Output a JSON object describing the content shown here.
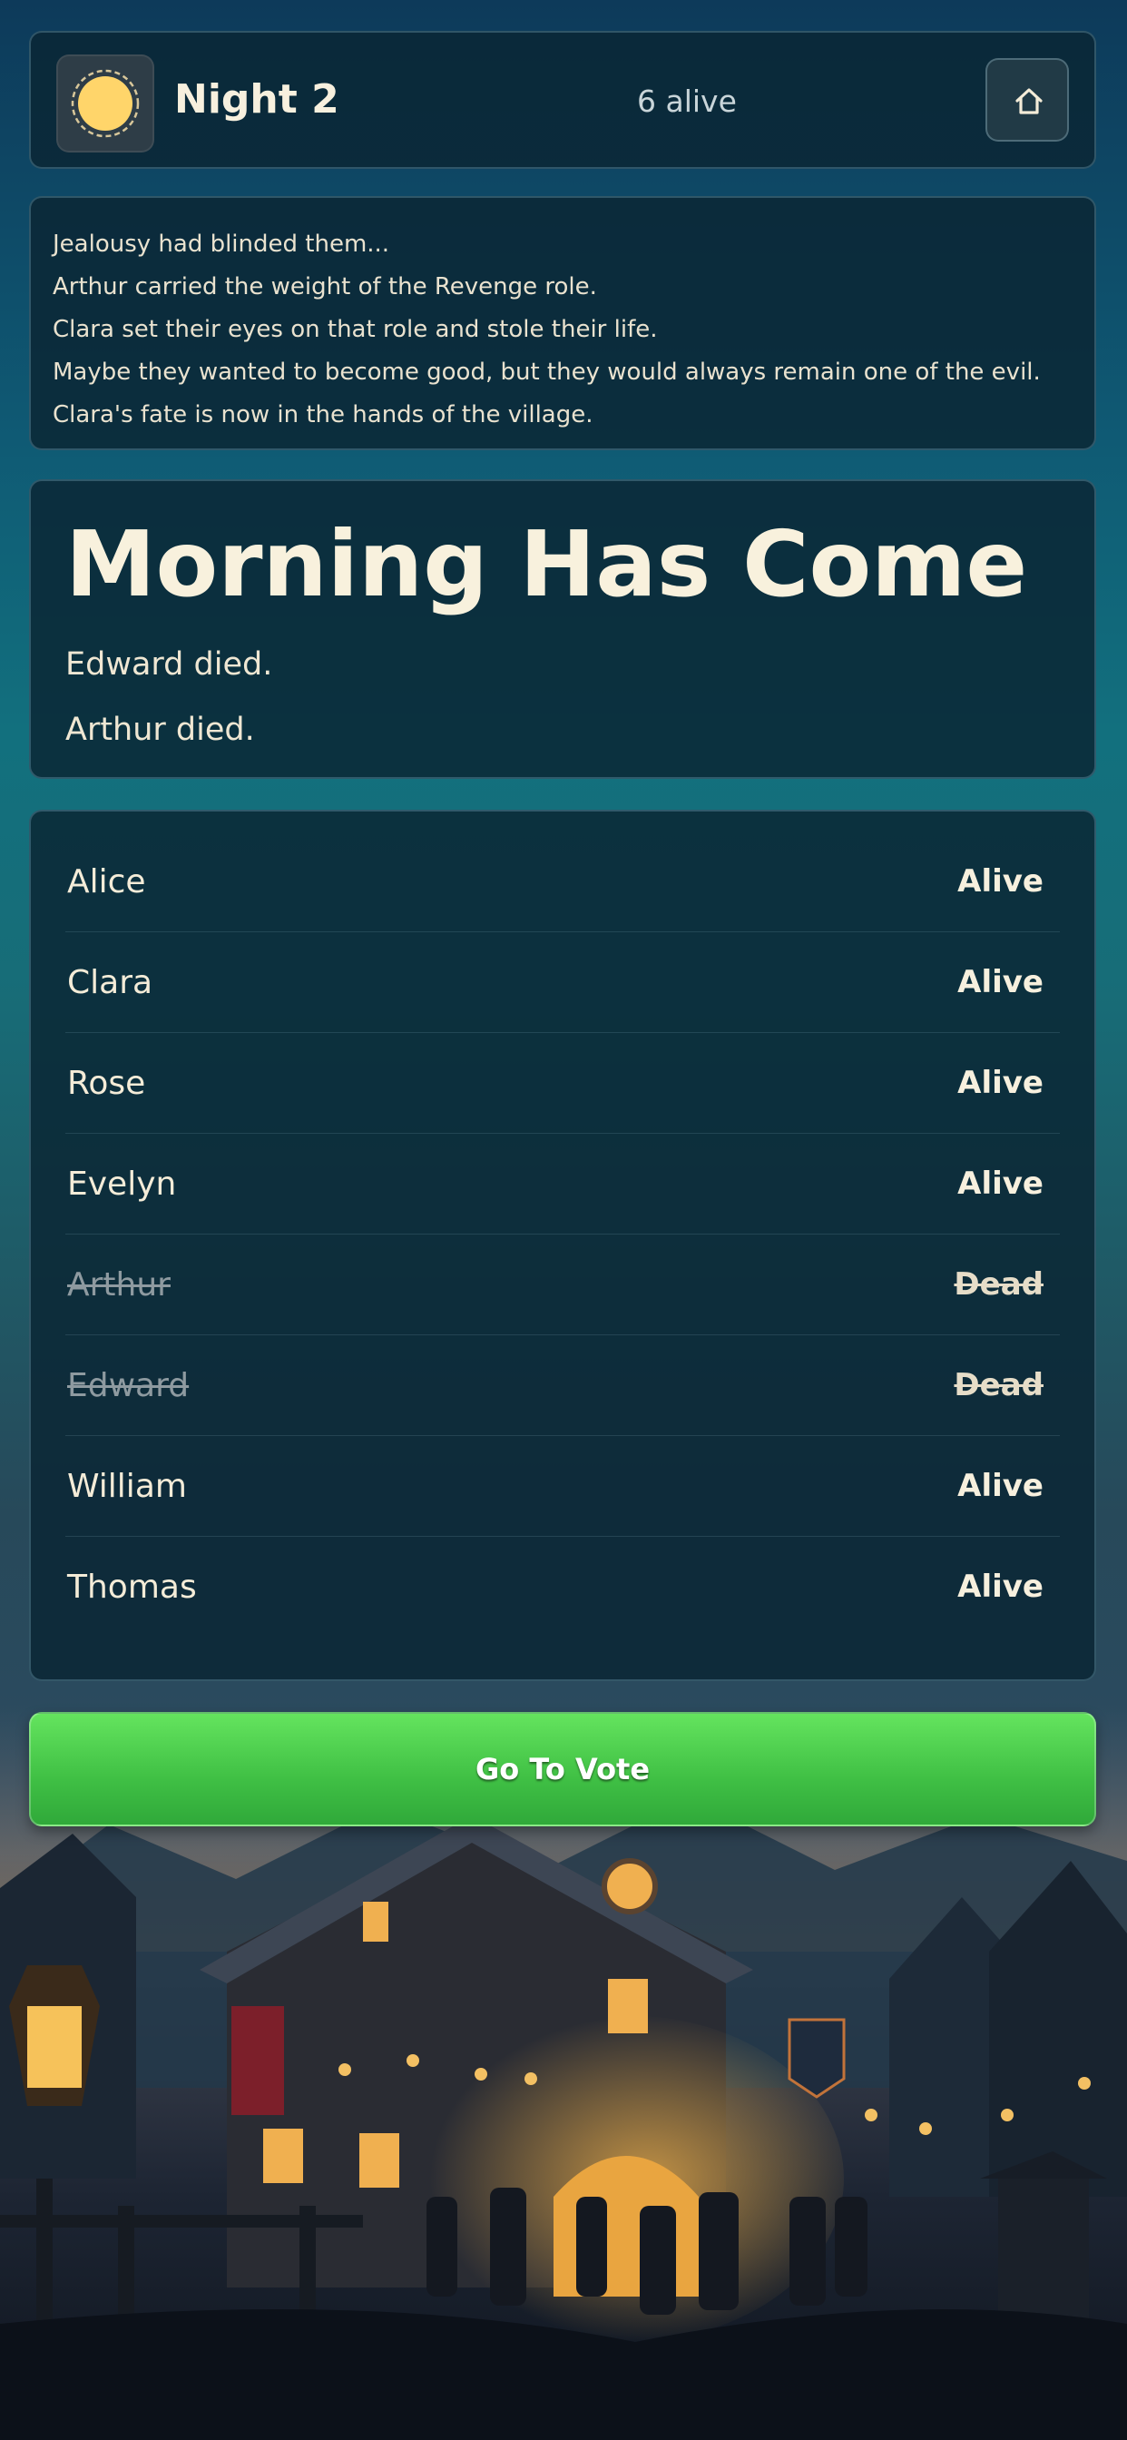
{
  "header": {
    "icon": "sun-icon",
    "title": "Night 2",
    "alive_count": "6 alive",
    "home_icon": "home-icon"
  },
  "story": {
    "lines": [
      "Jealousy had blinded them...",
      "Arthur carried the weight of the Revenge role.",
      "Clara set their eyes on that role and stole their life.",
      "Maybe they wanted to become good, but they would always remain one of the evil.",
      "Clara's fate is now in the hands of the village."
    ]
  },
  "morning": {
    "title": "Morning Has Come",
    "deaths": [
      "Edward died.",
      "Arthur died."
    ]
  },
  "players": [
    {
      "name": "Alice",
      "status": "Alive"
    },
    {
      "name": "Clara",
      "status": "Alive"
    },
    {
      "name": "Rose",
      "status": "Alive"
    },
    {
      "name": "Evelyn",
      "status": "Alive"
    },
    {
      "name": "Arthur",
      "status": "Dead"
    },
    {
      "name": "Edward",
      "status": "Dead"
    },
    {
      "name": "William",
      "status": "Alive"
    },
    {
      "name": "Thomas",
      "status": "Alive"
    }
  ],
  "vote_button": {
    "label": "Go To Vote"
  },
  "colors": {
    "accent_green": "#4cd14f",
    "panel_bg": "#0a2634",
    "sun_yellow": "#ffd56a",
    "text_cream": "#f4ecd8"
  }
}
